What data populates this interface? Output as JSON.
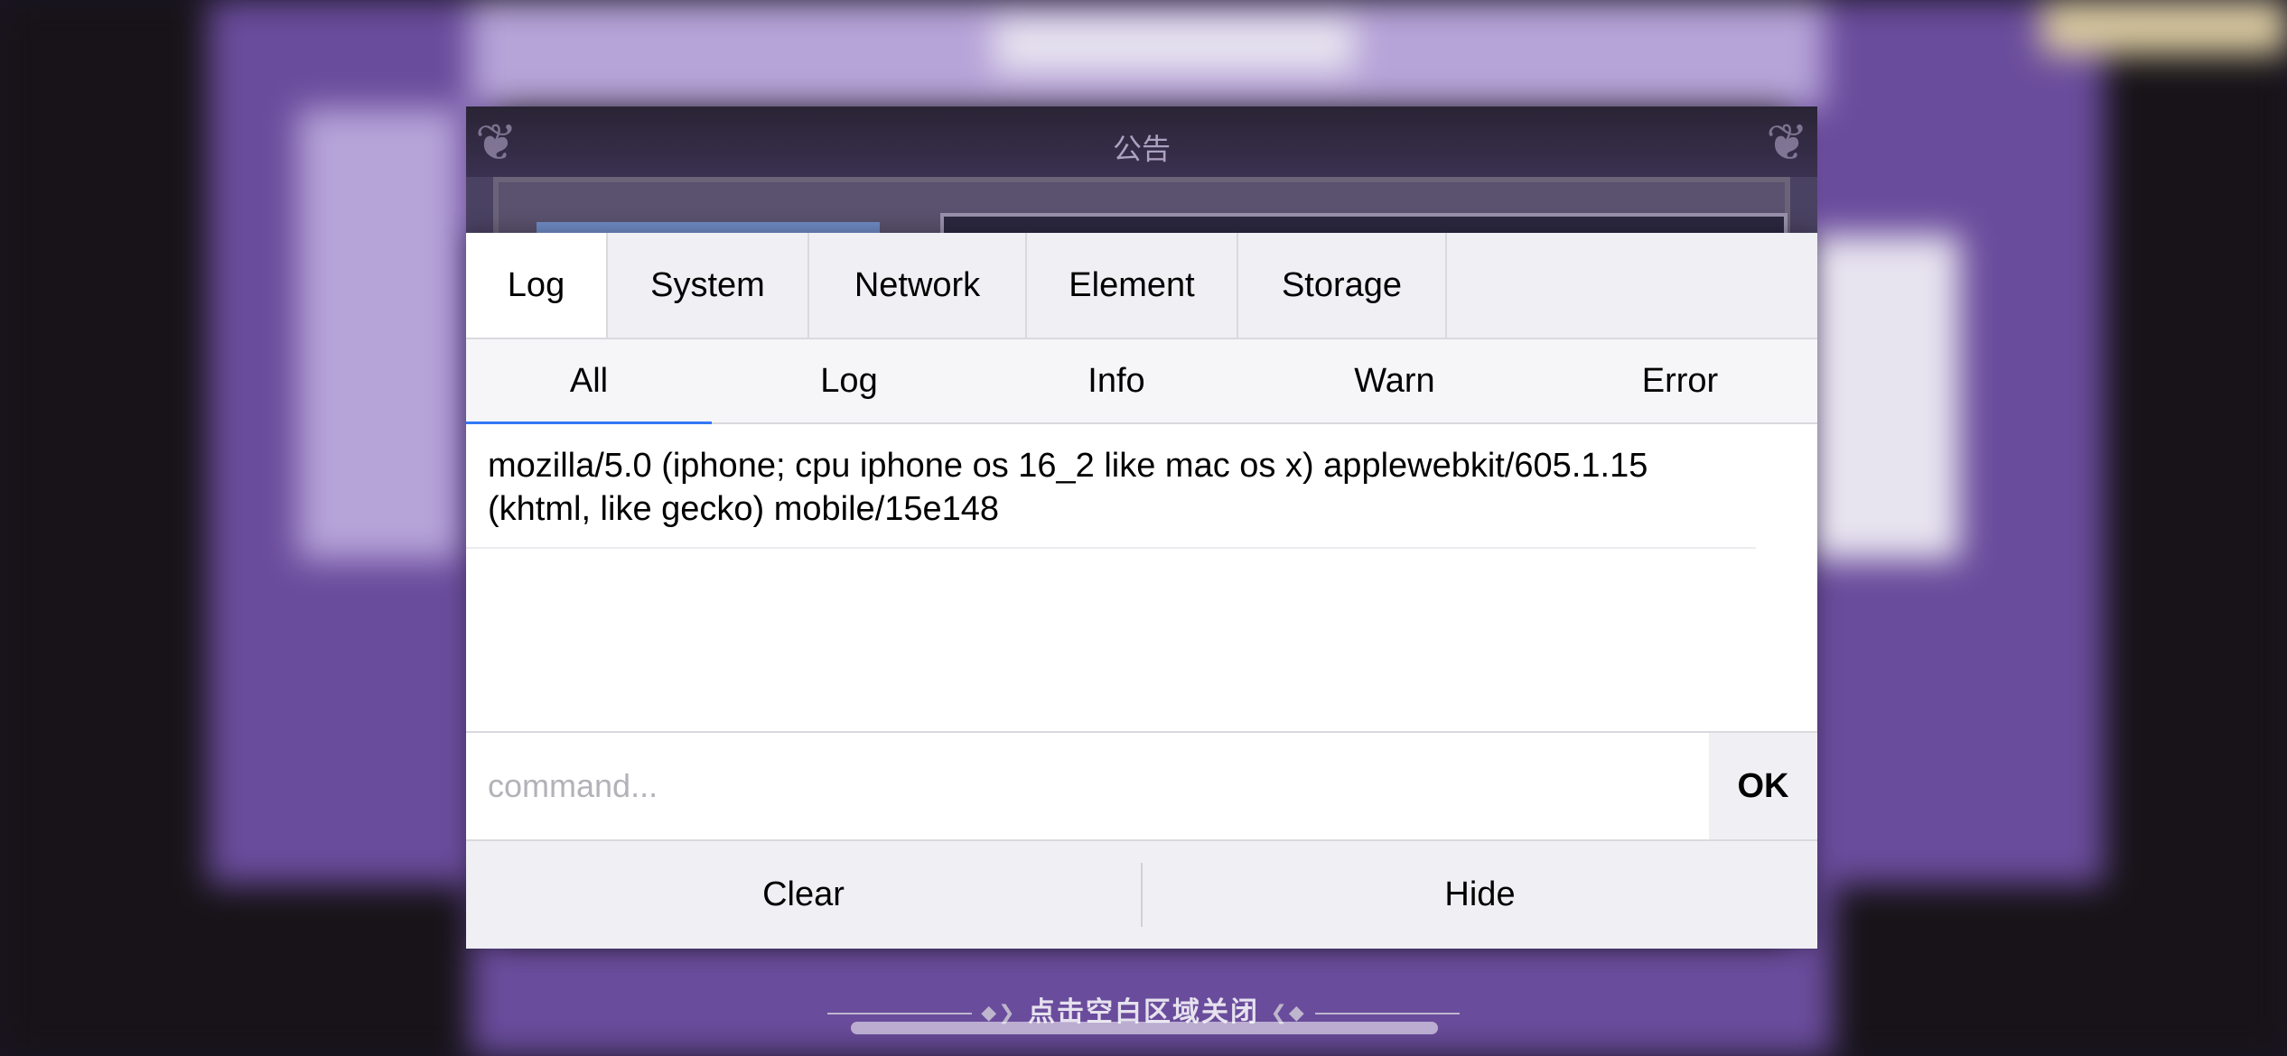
{
  "background": {
    "notice_title": "公告",
    "close_hint": "点击空白区域关闭"
  },
  "console": {
    "tabs": [
      {
        "label": "Log",
        "active": true
      },
      {
        "label": "System",
        "active": false
      },
      {
        "label": "Network",
        "active": false
      },
      {
        "label": "Element",
        "active": false
      },
      {
        "label": "Storage",
        "active": false
      }
    ],
    "subtabs": [
      {
        "label": "All",
        "active": true
      },
      {
        "label": "Log",
        "active": false
      },
      {
        "label": "Info",
        "active": false
      },
      {
        "label": "Warn",
        "active": false
      },
      {
        "label": "Error",
        "active": false
      }
    ],
    "log_entries": [
      "mozilla/5.0 (iphone; cpu iphone os 16_2 like mac os x) applewebkit/605.1.15 (khtml, like gecko) mobile/15e148"
    ],
    "command": {
      "placeholder": "command...",
      "value": "",
      "ok_label": "OK"
    },
    "footer": {
      "clear_label": "Clear",
      "hide_label": "Hide"
    },
    "colors": {
      "accent": "#3478f6",
      "toolbar_bg": "#efeff4",
      "border": "#d9d9de"
    }
  }
}
